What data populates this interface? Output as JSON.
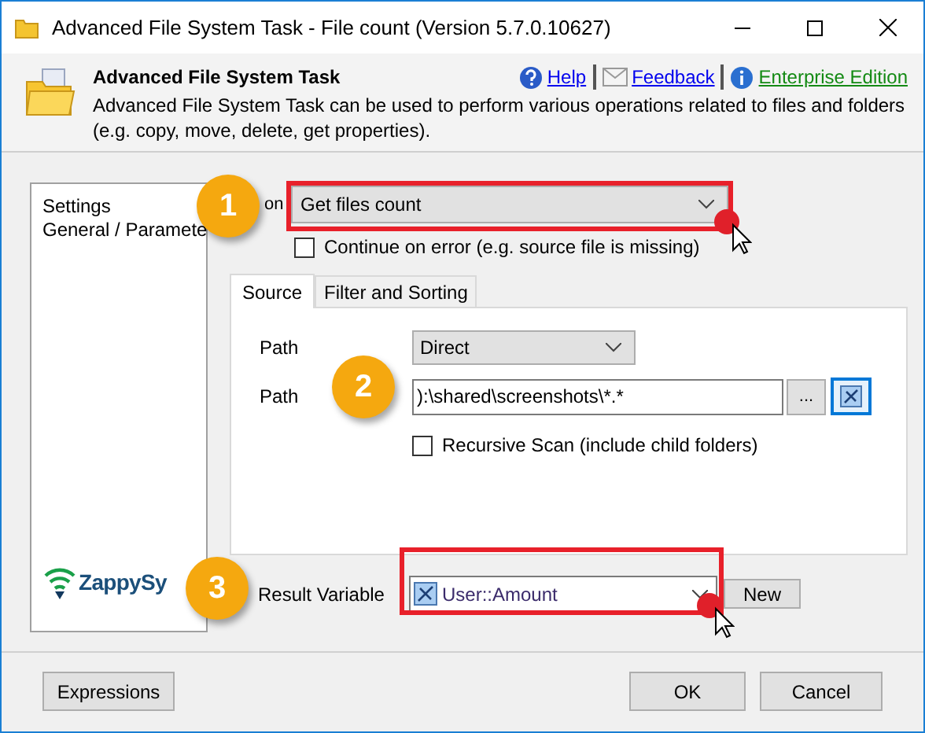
{
  "window": {
    "title": "Advanced File System Task - File count (Version 5.7.0.10627)"
  },
  "header": {
    "title": "Advanced File System Task",
    "description": "Advanced File System Task can be used to perform various operations related to files and folders (e.g. copy, move, delete, get properties).",
    "links": [
      {
        "kind": "help",
        "label": "Help"
      },
      {
        "kind": "feedback",
        "label": "Feedback"
      },
      {
        "kind": "edition",
        "label": "Enterprise Edition"
      }
    ]
  },
  "sidebar": {
    "items": [
      {
        "label": "Settings",
        "selected": false
      },
      {
        "label": "General / Paramete",
        "selected": false
      }
    ],
    "logo": "ZappySy"
  },
  "action": {
    "label": "on",
    "value": "Get files count"
  },
  "continue_on_error": {
    "label": "Continue on error (e.g. source file is missing)",
    "checked": false
  },
  "tabs": [
    {
      "label": "Source",
      "selected": true
    },
    {
      "label": "Filter and Sorting",
      "selected": false
    }
  ],
  "source": {
    "path_type": {
      "label": "Path",
      "value": "Direct"
    },
    "path": {
      "label": "Path",
      "value": "):\\shared\\screenshots\\*.*",
      "browse": "..."
    },
    "recursive": {
      "label": "Recursive Scan (include child folders)",
      "checked": false
    }
  },
  "result_variable": {
    "label": "Result Variable",
    "value": "User::Amount",
    "new_button": "New"
  },
  "callouts": [
    "1",
    "2",
    "3"
  ],
  "buttons": {
    "expressions": "Expressions",
    "ok": "OK",
    "cancel": "Cancel"
  }
}
